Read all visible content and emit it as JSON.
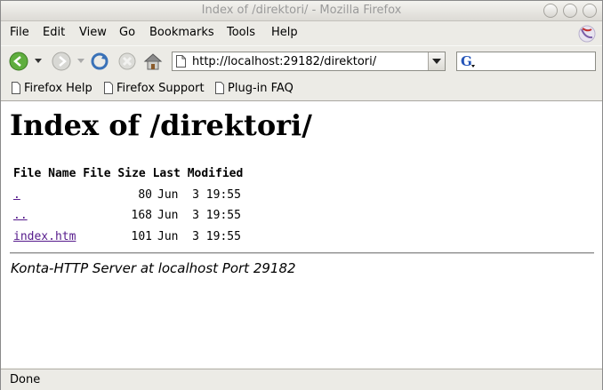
{
  "window": {
    "title": "Index of /direktori/ - Mozilla Firefox"
  },
  "menu": {
    "file": "File",
    "edit": "Edit",
    "view": "View",
    "go": "Go",
    "bookmarks": "Bookmarks",
    "tools": "Tools",
    "help": "Help"
  },
  "navigation": {
    "url": "http://localhost:29182/direktori/",
    "search_value": ""
  },
  "bookmarks_toolbar": [
    {
      "label": "Firefox Help"
    },
    {
      "label": "Firefox Support"
    },
    {
      "label": "Plug-in FAQ"
    }
  ],
  "page": {
    "heading": "Index of /direktori/",
    "table_headers": {
      "name": "File Name",
      "size": "File Size",
      "modified": "Last Modified"
    },
    "rows": [
      {
        "name": ".",
        "size": "80",
        "modified": "Jun  3 19:55"
      },
      {
        "name": "..",
        "size": "168",
        "modified": "Jun  3 19:55"
      },
      {
        "name": "index.htm",
        "size": "101",
        "modified": "Jun  3 19:55"
      }
    ],
    "footer": "Konta-HTTP Server at localhost Port 29182"
  },
  "status": {
    "text": "Done"
  },
  "colors": {
    "visited_link": "#551a8b",
    "chrome_bg": "#ecebe6"
  },
  "icons": [
    "back-arrow-icon",
    "forward-arrow-icon",
    "reload-icon",
    "stop-icon",
    "home-icon",
    "page-icon",
    "google-search-icon",
    "firefox-throbber-icon",
    "bookmark-page-icon"
  ]
}
